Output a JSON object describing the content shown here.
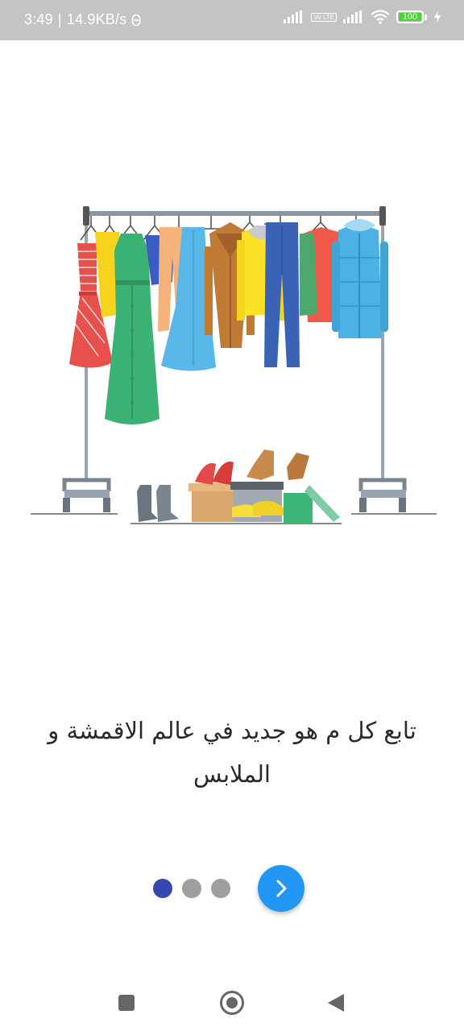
{
  "status_bar": {
    "time": "3:49",
    "separator": "|",
    "network_speed": "14.9KB/s",
    "volte_label": "Vo LTE",
    "battery_level": "100",
    "icons": [
      "signal-icon",
      "volte-icon",
      "signal-icon",
      "wifi-icon",
      "battery-icon",
      "charging-icon"
    ]
  },
  "onboarding": {
    "illustration": "clothing-rack-illustration",
    "caption": "تابع كل م هو جديد في عالم الاقمشة و الملابس",
    "page_index": 0,
    "page_count": 3,
    "next_icon": "chevron-right-icon"
  },
  "colors": {
    "accent": "#2196f3",
    "dot_active": "#3548b0",
    "dot_inactive": "#9e9e9e",
    "status_bar": "#c4c4c4"
  },
  "nav_bar": {
    "icons": [
      "recents-square-icon",
      "home-circle-icon",
      "back-triangle-icon"
    ]
  }
}
